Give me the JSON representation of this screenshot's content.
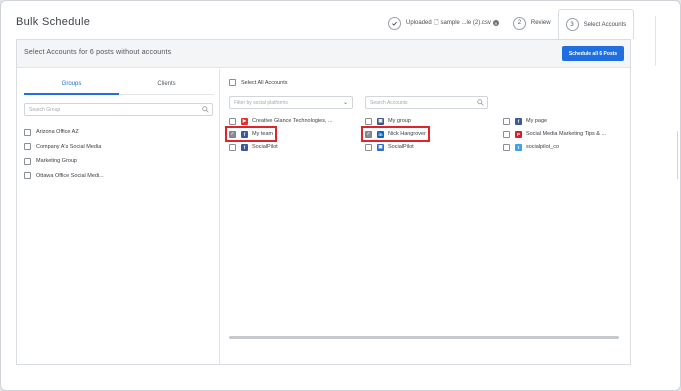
{
  "window": {
    "title": "Bulk Schedule"
  },
  "steps": [
    {
      "number": "",
      "label": "Uploaded",
      "file": "sample ...le (2).csv",
      "state": "done"
    },
    {
      "number": "2",
      "label": "Review",
      "state": "pending"
    },
    {
      "number": "3",
      "label": "Select Accounts",
      "state": "active"
    }
  ],
  "header": {
    "text": "Select Accounts for 6 posts without accounts",
    "primary_button": "Schedule all 6 Posts"
  },
  "left": {
    "tabs": [
      "Groups",
      "Clients"
    ],
    "active_tab": "Groups",
    "search_placeholder": "Search Group",
    "groups": [
      {
        "label": "Arizona Office AZ",
        "checked": false
      },
      {
        "label": "Company A's Social Media",
        "checked": false
      },
      {
        "label": "Marketing Group",
        "checked": false
      },
      {
        "label": "Ottawa Office Social Medi...",
        "checked": false
      }
    ]
  },
  "right": {
    "select_all_label": "Select All Accounts",
    "filter_placeholder": "Filter by social platforms",
    "search_placeholder": "Search Accounts",
    "accounts": [
      {
        "label": "Creative Glance Technologies, ...",
        "icon": "youtube-icon",
        "color": "#e0322b",
        "glyph": "▶",
        "checked": false,
        "highlight": false
      },
      {
        "label": "My group",
        "icon": "group-icon",
        "color": "#3c5a8c",
        "glyph": "▣",
        "checked": false,
        "highlight": false
      },
      {
        "label": "My page",
        "icon": "facebook-icon",
        "color": "#3b5998",
        "glyph": "f",
        "checked": false,
        "highlight": false
      },
      {
        "label": "My team",
        "icon": "facebook-icon",
        "color": "#3b5998",
        "glyph": "f",
        "checked": true,
        "highlight": true
      },
      {
        "label": "Nick Hangrover",
        "icon": "linkedin-icon",
        "color": "#0a66c2",
        "glyph": "in",
        "checked": true,
        "highlight": true
      },
      {
        "label": "Social Media Marketing Tips & ...",
        "icon": "pinterest-icon",
        "color": "#d2202c",
        "glyph": "P",
        "checked": false,
        "highlight": false
      },
      {
        "label": "SocialPilot",
        "icon": "facebook-icon",
        "color": "#3b5998",
        "glyph": "f",
        "checked": false,
        "highlight": false
      },
      {
        "label": "SocialPilot",
        "icon": "google-business-icon",
        "color": "#2c6ecb",
        "glyph": "▣",
        "checked": false,
        "highlight": false
      },
      {
        "label": "socialpilot_co",
        "icon": "twitter-icon",
        "color": "#3ca3e6",
        "glyph": "t",
        "checked": false,
        "highlight": false
      }
    ]
  },
  "colors": {
    "accent": "#1f6fe0",
    "highlight": "#e0242a"
  }
}
